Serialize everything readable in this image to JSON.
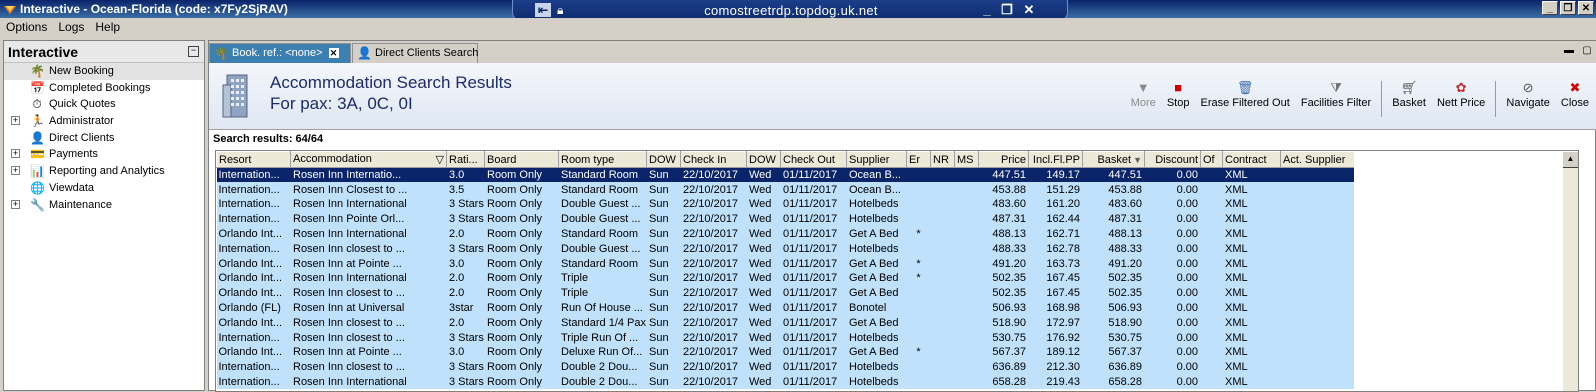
{
  "window": {
    "title": "Interactive - Ocean-Florida (code: x7Fy2SjRAV)",
    "rdp_host": "comostreetrdp.topdog.uk.net"
  },
  "menu": [
    "Options",
    "Logs",
    "Help"
  ],
  "nav": {
    "title": "Interactive",
    "items": [
      {
        "label": "New Booking",
        "icon": "palm-tree-icon",
        "expandable": false
      },
      {
        "label": "Completed Bookings",
        "icon": "booking-icon",
        "expandable": false
      },
      {
        "label": "Quick Quotes",
        "icon": "quote-icon",
        "expandable": false
      },
      {
        "label": "Administrator",
        "icon": "admin-icon",
        "expandable": true
      },
      {
        "label": "Direct Clients",
        "icon": "clients-icon",
        "expandable": false
      },
      {
        "label": "Payments",
        "icon": "payments-icon",
        "expandable": true
      },
      {
        "label": "Reporting and Analytics",
        "icon": "reports-icon",
        "expandable": true
      },
      {
        "label": "Viewdata",
        "icon": "globe-icon",
        "expandable": false
      },
      {
        "label": "Maintenance",
        "icon": "maintenance-icon",
        "expandable": true
      }
    ]
  },
  "tabs": [
    {
      "label": "Book. ref.: <none>",
      "active": true
    },
    {
      "label": "Direct Clients Search",
      "active": false
    }
  ],
  "header": {
    "title": "Accommodation Search Results",
    "subtitle": "For pax: 3A, 0C, 0I"
  },
  "toolbar": [
    {
      "label": "More",
      "icon": "more-icon",
      "disabled": true
    },
    {
      "label": "Stop",
      "icon": "stop-icon",
      "disabled": false
    },
    {
      "label": "Erase Filtered Out",
      "icon": "erase-icon",
      "disabled": false
    },
    {
      "label": "Facilities Filter",
      "icon": "filter-icon",
      "disabled": false
    },
    {
      "label": "Basket",
      "icon": "basket-icon",
      "disabled": false
    },
    {
      "label": "Nett Price",
      "icon": "nett-price-icon",
      "disabled": false
    },
    {
      "label": "Navigate",
      "icon": "navigate-icon",
      "disabled": false
    },
    {
      "label": "Close",
      "icon": "close-icon",
      "disabled": false
    }
  ],
  "results_label": "Search results: 64/64",
  "grid": {
    "columns": [
      "Resort",
      "Accommodation",
      "Rati...",
      "Board",
      "Room type",
      "DOW",
      "Check In",
      "DOW",
      "Check Out",
      "Supplier",
      "Er",
      "NR",
      "MS",
      "Price",
      "Incl.Fl.PP",
      "Basket",
      "Discount",
      "Of",
      "Contract",
      "Act. Supplier"
    ],
    "rows": [
      [
        "Internation...",
        "Rosen Inn Internatio...",
        "3.0",
        "Room Only",
        "Standard Room",
        "Sun",
        "22/10/2017",
        "Wed",
        "01/11/2017",
        "Ocean B...",
        "",
        "",
        "",
        "447.51",
        "149.17",
        "447.51",
        "0.00",
        "",
        "XML",
        ""
      ],
      [
        "Internation...",
        "Rosen Inn Closest to ...",
        "3.5",
        "Room Only",
        "Standard Room",
        "Sun",
        "22/10/2017",
        "Wed",
        "01/11/2017",
        "Ocean B...",
        "",
        "",
        "",
        "453.88",
        "151.29",
        "453.88",
        "0.00",
        "",
        "XML",
        ""
      ],
      [
        "Internation...",
        "Rosen Inn International",
        "3 Stars",
        "Room Only",
        "Double Guest ...",
        "Sun",
        "22/10/2017",
        "Wed",
        "01/11/2017",
        "Hotelbeds",
        "",
        "",
        "",
        "483.60",
        "161.20",
        "483.60",
        "0.00",
        "",
        "XML",
        ""
      ],
      [
        "Internation...",
        "Rosen Inn Pointe Orl...",
        "3 Stars",
        "Room Only",
        "Double Guest ...",
        "Sun",
        "22/10/2017",
        "Wed",
        "01/11/2017",
        "Hotelbeds",
        "",
        "",
        "",
        "487.31",
        "162.44",
        "487.31",
        "0.00",
        "",
        "XML",
        ""
      ],
      [
        "Orlando Int...",
        "Rosen Inn International",
        "2.0",
        "Room Only",
        "Standard Room",
        "Sun",
        "22/10/2017",
        "Wed",
        "01/11/2017",
        "Get A Bed",
        "*",
        "",
        "",
        "488.13",
        "162.71",
        "488.13",
        "0.00",
        "",
        "XML",
        ""
      ],
      [
        "Internation...",
        "Rosen Inn closest to ...",
        "3 Stars",
        "Room Only",
        "Double Guest ...",
        "Sun",
        "22/10/2017",
        "Wed",
        "01/11/2017",
        "Hotelbeds",
        "",
        "",
        "",
        "488.33",
        "162.78",
        "488.33",
        "0.00",
        "",
        "XML",
        ""
      ],
      [
        "Orlando Int...",
        "Rosen Inn at Pointe ...",
        "3.0",
        "Room Only",
        "Standard Room",
        "Sun",
        "22/10/2017",
        "Wed",
        "01/11/2017",
        "Get A Bed",
        "*",
        "",
        "",
        "491.20",
        "163.73",
        "491.20",
        "0.00",
        "",
        "XML",
        ""
      ],
      [
        "Orlando Int...",
        "Rosen Inn International",
        "2.0",
        "Room Only",
        "Triple",
        "Sun",
        "22/10/2017",
        "Wed",
        "01/11/2017",
        "Get A Bed",
        "*",
        "",
        "",
        "502.35",
        "167.45",
        "502.35",
        "0.00",
        "",
        "XML",
        ""
      ],
      [
        "Orlando Int...",
        "Rosen Inn closest to ...",
        "2.0",
        "Room Only",
        "Triple",
        "Sun",
        "22/10/2017",
        "Wed",
        "01/11/2017",
        "Get A Bed",
        "",
        "",
        "",
        "502.35",
        "167.45",
        "502.35",
        "0.00",
        "",
        "XML",
        ""
      ],
      [
        "Orlando (FL)",
        "Rosen Inn at Universal",
        "3star",
        "Room Only",
        "Run Of House ...",
        "Sun",
        "22/10/2017",
        "Wed",
        "01/11/2017",
        "Bonotel",
        "",
        "",
        "",
        "506.93",
        "168.98",
        "506.93",
        "0.00",
        "",
        "XML",
        ""
      ],
      [
        "Orlando Int...",
        "Rosen Inn closest to ...",
        "2.0",
        "Room Only",
        "Standard 1/4 Pax",
        "Sun",
        "22/10/2017",
        "Wed",
        "01/11/2017",
        "Get A Bed",
        "",
        "",
        "",
        "518.90",
        "172.97",
        "518.90",
        "0.00",
        "",
        "XML",
        ""
      ],
      [
        "Internation...",
        "Rosen Inn closest to ...",
        "3 Stars",
        "Room Only",
        "Triple Run Of ...",
        "Sun",
        "22/10/2017",
        "Wed",
        "01/11/2017",
        "Hotelbeds",
        "",
        "",
        "",
        "530.75",
        "176.92",
        "530.75",
        "0.00",
        "",
        "XML",
        ""
      ],
      [
        "Orlando Int...",
        "Rosen Inn at Pointe ...",
        "3.0",
        "Room Only",
        "Deluxe Run Of...",
        "Sun",
        "22/10/2017",
        "Wed",
        "01/11/2017",
        "Get A Bed",
        "*",
        "",
        "",
        "567.37",
        "189.12",
        "567.37",
        "0.00",
        "",
        "XML",
        ""
      ],
      [
        "Internation...",
        "Rosen Inn closest to ...",
        "3 Stars",
        "Room Only",
        "Double 2 Dou...",
        "Sun",
        "22/10/2017",
        "Wed",
        "01/11/2017",
        "Hotelbeds",
        "",
        "",
        "",
        "636.89",
        "212.30",
        "636.89",
        "0.00",
        "",
        "XML",
        ""
      ],
      [
        "Internation...",
        "Rosen Inn International",
        "3 Stars",
        "Room Only",
        "Double 2 Dou...",
        "Sun",
        "22/10/2017",
        "Wed",
        "01/11/2017",
        "Hotelbeds",
        "",
        "",
        "",
        "658.28",
        "219.43",
        "658.28",
        "0.00",
        "",
        "XML",
        ""
      ]
    ]
  }
}
